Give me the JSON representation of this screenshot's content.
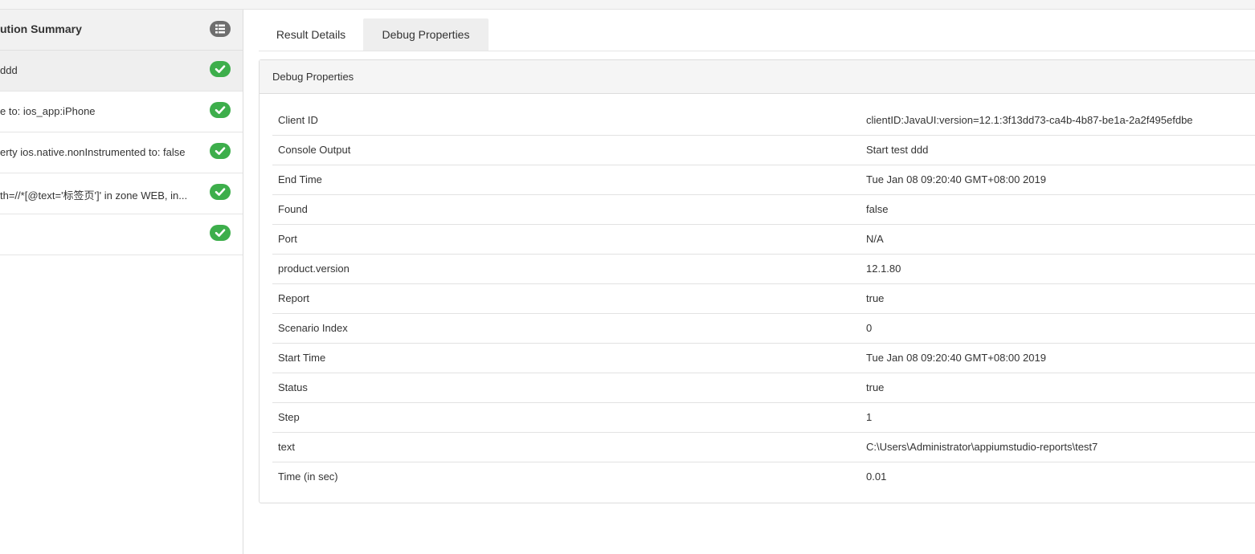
{
  "sidebar": {
    "title": "ution Summary",
    "steps": [
      {
        "label": " ddd",
        "status": "passed"
      },
      {
        "label": "e to: ios_app:iPhone",
        "status": "passed"
      },
      {
        "label": "erty ios.native.nonInstrumented to: false",
        "status": "passed"
      },
      {
        "label": "th=//*[@text='标签页']' in zone WEB, in...",
        "status": "passed"
      },
      {
        "label": "",
        "status": "passed"
      }
    ]
  },
  "tabs": [
    {
      "label": "Result Details"
    },
    {
      "label": "Debug Properties",
      "active": true
    }
  ],
  "panel": {
    "title": "Debug Properties",
    "rows": [
      {
        "key": "Client ID",
        "value": "clientID:JavaUI:version=12.1:3f13dd73-ca4b-4b87-be1a-2a2f495efdbe"
      },
      {
        "key": "Console Output",
        "value": "Start test ddd"
      },
      {
        "key": "End Time",
        "value": "Tue Jan 08 09:20:40 GMT+08:00 2019"
      },
      {
        "key": "Found",
        "value": "false"
      },
      {
        "key": "Port",
        "value": "N/A"
      },
      {
        "key": "product.version",
        "value": "12.1.80"
      },
      {
        "key": "Report",
        "value": "true"
      },
      {
        "key": "Scenario Index",
        "value": "0"
      },
      {
        "key": "Start Time",
        "value": "Tue Jan 08 09:20:40 GMT+08:00 2019"
      },
      {
        "key": "Status",
        "value": "true"
      },
      {
        "key": "Step",
        "value": "1"
      },
      {
        "key": "text",
        "value": "C:\\Users\\Administrator\\appiumstudio-reports\\test7"
      },
      {
        "key": "Time (in sec)",
        "value": "0.01"
      }
    ]
  },
  "colors": {
    "success": "#3dae4b",
    "badge_gray": "#6e6e6e",
    "selected_bg": "#efefef"
  },
  "icons": {
    "summary_badge": "list-icon",
    "step_badge": "check-icon"
  }
}
